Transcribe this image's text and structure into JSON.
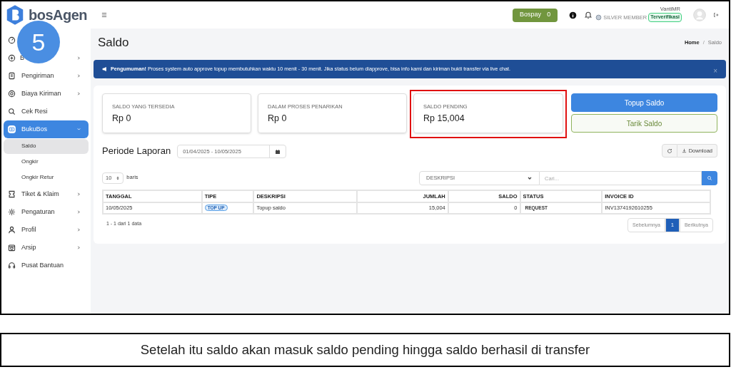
{
  "logo": {
    "text": "bosAgen"
  },
  "step_badge": "5",
  "sidebar": {
    "items": [
      {
        "has_submenu": false,
        "selected": false
      },
      {
        "label": "B",
        "has_submenu": true,
        "expanded": false,
        "selected": false
      },
      {
        "label": "Pengiriman",
        "has_submenu": true,
        "expanded": false,
        "selected": false
      },
      {
        "label": "Biaya Kiriman",
        "has_submenu": true,
        "expanded": false,
        "selected": false
      },
      {
        "label": "Cek Resi",
        "has_submenu": false,
        "selected": false
      },
      {
        "label": "BukuBos",
        "has_submenu": true,
        "expanded": true,
        "selected": true,
        "children": [
          {
            "label": "Saldo",
            "selected": true
          },
          {
            "label": "Ongkir",
            "selected": false
          },
          {
            "label": "Ongkir Retur",
            "selected": false
          }
        ]
      },
      {
        "label": "Tiket & Klaim",
        "has_submenu": true,
        "expanded": false,
        "selected": false
      },
      {
        "label": "Pengaturan",
        "has_submenu": true,
        "expanded": false,
        "selected": false
      },
      {
        "label": "Profil",
        "has_submenu": true,
        "expanded": false,
        "selected": false
      },
      {
        "label": "Arsip",
        "has_submenu": true,
        "expanded": false,
        "selected": false
      },
      {
        "label": "Pusat Bantuan",
        "has_submenu": false,
        "selected": false
      }
    ]
  },
  "topbar": {
    "wallet": {
      "label": "Bospay",
      "value": "0"
    },
    "member_level": "SILVER MEMBER",
    "verified_badge": "Terverifikasi",
    "username": "VantiMR"
  },
  "page": {
    "title": "Saldo",
    "breadcrumb": [
      {
        "label": "Home",
        "current": false
      },
      {
        "label": "Saldo",
        "current": true
      }
    ],
    "breadcrumb_separator": "/"
  },
  "alert": {
    "text": "**Pengumuman!** Proses system auto approve topup membutuhkan waktu 10 menit - 30 menit. Jika status belum diapprove, bisa info kami dan kiriman bukti transfer via live chat.",
    "close": "×"
  },
  "stats": [
    {
      "label": "SALDO YANG TERSEDIA",
      "value": "Rp 0",
      "highlighted": false
    },
    {
      "label": "DALAM PROSES PENARIKAN",
      "value": "Rp 0",
      "highlighted": false
    },
    {
      "label": "SALDO PENDING",
      "value": "Rp 15,004",
      "highlighted": true
    }
  ],
  "actions": [
    {
      "label": "Topup Saldo",
      "kind": "primary"
    },
    {
      "label": "Tarik Saldo",
      "kind": "outline"
    }
  ],
  "report": {
    "title": "Periode Laporan",
    "date_range": "01/04/2025 - 10/05/2025",
    "download": "Download"
  },
  "table_controls": {
    "page_size": "10",
    "page_size_label": "baris",
    "filter": "DESKRIPSI",
    "search_placeholder": "Cari..."
  },
  "table": {
    "columns": [
      {
        "label": "TANGGAL",
        "kind": "text"
      },
      {
        "label": "TIPE",
        "kind": "text"
      },
      {
        "label": "DESKRIPSI",
        "kind": "text"
      },
      {
        "label": "JUMLAH",
        "kind": "number"
      },
      {
        "label": "SALDO",
        "kind": "number"
      },
      {
        "label": "STATUS",
        "kind": "text"
      },
      {
        "label": "INVOICE ID",
        "kind": "text"
      }
    ],
    "rows": [
      {
        "cells": [
          {
            "text": "10/05/2025",
            "kind": "text"
          },
          {
            "text": "TOP UP",
            "kind": "badge"
          },
          {
            "text": "Topup saldo",
            "kind": "text"
          },
          {
            "text": "15,004",
            "kind": "text"
          },
          {
            "text": "0",
            "kind": "text"
          },
          {
            "text": "REQUEST",
            "kind": "status"
          },
          {
            "text": "INV1374192610255",
            "kind": "text"
          }
        ]
      }
    ]
  },
  "table_info": "1 - 1 dari 1 data",
  "pagination": [
    {
      "label": "Sebelumnya",
      "selected": false
    },
    {
      "label": "1",
      "selected": true
    },
    {
      "label": "Berikutnya",
      "selected": false
    }
  ],
  "caption": "Setelah itu saldo akan masuk saldo pending hingga saldo berhasil di transfer"
}
